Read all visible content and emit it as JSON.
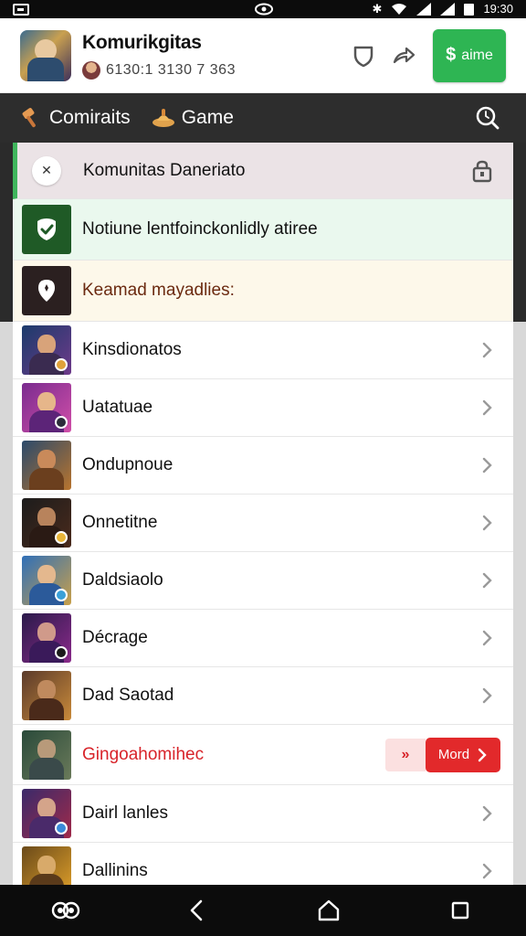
{
  "status_bar": {
    "time": "19:30"
  },
  "header": {
    "title": "Komurikgitas",
    "subtitle": "6130:1 3130 7 363",
    "join_label": "aime",
    "join_symbol": "$"
  },
  "nav": {
    "tabs": [
      {
        "label": "Comiraits",
        "icon": "hammer-icon"
      },
      {
        "label": "Game",
        "icon": "game-icon"
      }
    ]
  },
  "panel": {
    "head_title": "Komunitas Daneriato",
    "notice_text": "Notiune lentfoinckonlidly atiree",
    "warn_text": "Keamad mayadlies:",
    "items": [
      {
        "label": "Kinsdionatos"
      },
      {
        "label": "Uatatuae"
      },
      {
        "label": "Ondupnoue"
      },
      {
        "label": "Onnetitne"
      },
      {
        "label": "Daldsiaolo"
      },
      {
        "label": "Décrage"
      },
      {
        "label": "Dad Saotad"
      },
      {
        "label": "Gingoahomihec",
        "more_label": "Mord"
      },
      {
        "label": "Dairl lanles"
      },
      {
        "label": "Dallinins"
      }
    ]
  },
  "colors": {
    "accent_green": "#2eb553",
    "alert_red": "#e2292b",
    "nav_dark": "#2d2d2d"
  }
}
